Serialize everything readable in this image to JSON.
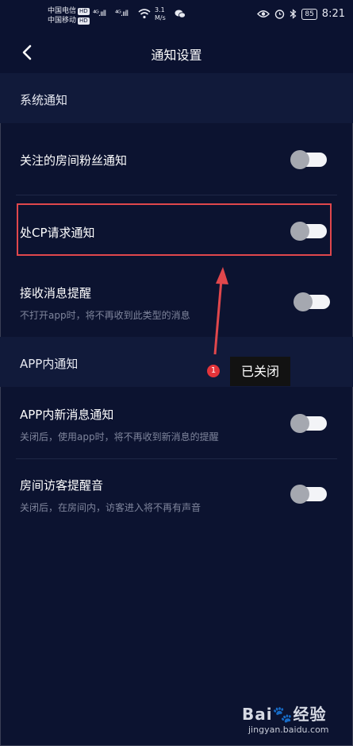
{
  "status_bar": {
    "carrier1": "中国电信",
    "carrier2": "中国移动",
    "hd_badge": "HD",
    "signal1": "⁴ᴳ.ııll",
    "signal2": "⁴ᴳ.ııll",
    "net_speed": "3.1",
    "net_unit": "M/s",
    "battery": "85",
    "time": "8:21",
    "icons": [
      "eye-icon",
      "alarm-icon",
      "bluetooth-icon",
      "battery-icon",
      "wifi-icon",
      "wechat-icon"
    ]
  },
  "nav": {
    "title": "通知设置",
    "back_icon": "chevron-left-icon"
  },
  "sections": {
    "system": {
      "title": "系统通知",
      "items": [
        {
          "label": "关注的房间粉丝通知",
          "sub": "",
          "on": false
        },
        {
          "label": "处CP请求通知",
          "sub": "",
          "on": false
        },
        {
          "label": "接收消息提醒",
          "sub": "不打开app时，将不再收到此类型的消息",
          "on": false
        }
      ]
    },
    "app": {
      "title": "APP内通知",
      "items": [
        {
          "label": "APP内新消息通知",
          "sub": "关闭后，使用app时，将不再收到新消息的提醒",
          "on": false
        },
        {
          "label": "房间访客提醒音",
          "sub": "关闭后，在房间内，访客进入将不再有声音",
          "on": false
        }
      ]
    }
  },
  "annotation": {
    "number": "1",
    "text": "已关闭",
    "color": "#e0474c"
  },
  "watermark": {
    "brand": "Bai🐾经验",
    "url": "jingyan.baidu.com"
  },
  "colors": {
    "background": "#0c1330",
    "section_header": "#111a3a",
    "toggle_track": "#f3f4f7",
    "toggle_knob": "#a5a8b0"
  }
}
